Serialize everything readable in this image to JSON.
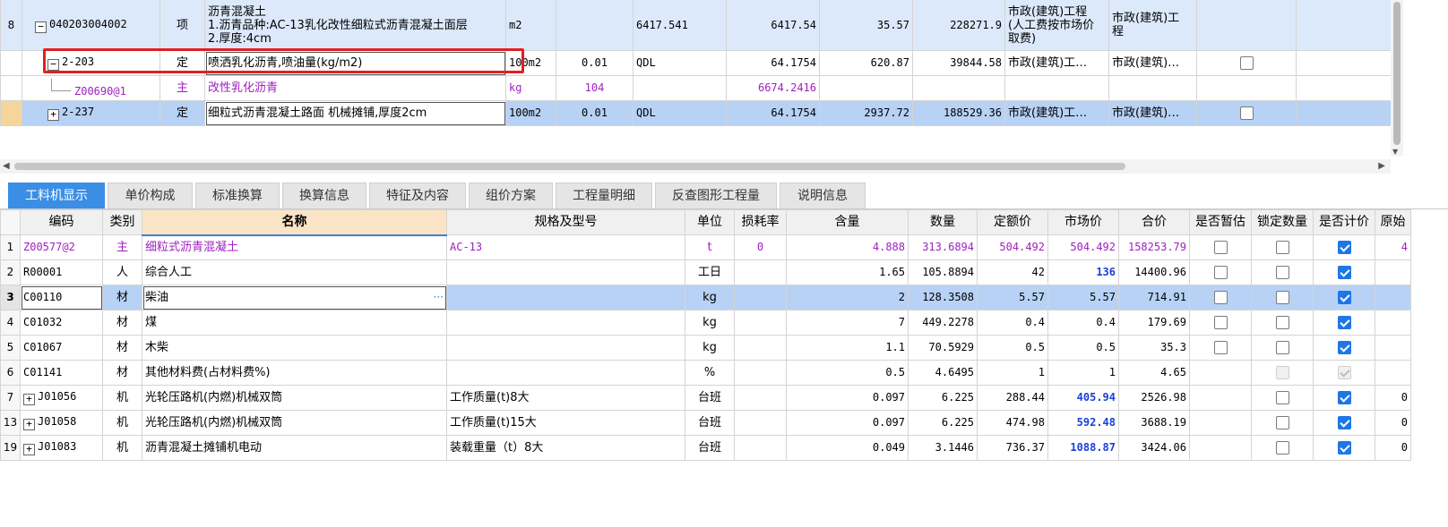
{
  "top_rows": [
    {
      "num": "8",
      "code": "040203004002",
      "expand": "−",
      "type": "项",
      "name_lines": [
        "沥青混凝土",
        "1.沥青品种:AC-13乳化改性细粒式沥青混凝土面层",
        "2.厚度:4cm"
      ],
      "unit": "m2",
      "qty_factor": "",
      "qty_expr": "6417.541",
      "quantity": "6417.54",
      "unit_price": "35.57",
      "total": "228271.9",
      "fee_type_lines": [
        "市政(建筑)工程",
        "(人工费按市场价",
        "取费)"
      ],
      "major_lines": [
        "市政(建筑)工",
        "程"
      ],
      "checkbox": "none"
    },
    {
      "num": "",
      "code": "2-203",
      "expand": "−",
      "type": "定",
      "name_lines": [
        "喷洒乳化沥青,喷油量(kg/m2)"
      ],
      "unit": "100m2",
      "qty_factor": "0.01",
      "qty_expr": "QDL",
      "quantity": "64.1754",
      "unit_price": "620.87",
      "total": "39844.58",
      "fee_type_lines": [
        "市政(建筑)工…"
      ],
      "major_lines": [
        "市政(建筑)…"
      ],
      "checkbox": "unchecked"
    },
    {
      "num": "",
      "code": "Z00690@1",
      "expand": "",
      "type": "主",
      "name_lines": [
        "改性乳化沥青"
      ],
      "unit": "kg",
      "qty_factor": "104",
      "qty_expr": "",
      "quantity": "6674.2416",
      "unit_price": "",
      "total": "",
      "fee_type_lines": [
        ""
      ],
      "major_lines": [
        ""
      ],
      "checkbox": "none"
    },
    {
      "num": "",
      "code": "2-237",
      "expand": "+",
      "type": "定",
      "name_lines": [
        "细粒式沥青混凝土路面 机械摊铺,厚度2cm"
      ],
      "unit": "100m2",
      "qty_factor": "0.01",
      "qty_expr": "QDL",
      "quantity": "64.1754",
      "unit_price": "2937.72",
      "total": "188529.36",
      "fee_type_lines": [
        "市政(建筑)工…"
      ],
      "major_lines": [
        "市政(建筑)…"
      ],
      "checkbox": "unchecked"
    }
  ],
  "tabs": [
    "工料机显示",
    "单价构成",
    "标准换算",
    "换算信息",
    "特征及内容",
    "组价方案",
    "工程量明细",
    "反查图形工程量",
    "说明信息"
  ],
  "bottom_headers": [
    "",
    "编码",
    "类别",
    "名称",
    "规格及型号",
    "单位",
    "损耗率",
    "含量",
    "数量",
    "定额价",
    "市场价",
    "合价",
    "是否暂估",
    "锁定数量",
    "是否计价",
    "原始"
  ],
  "bottom_rows": [
    {
      "num": "1",
      "expand": "",
      "code": "Z00577@2",
      "cat": "主",
      "name": "细粒式沥青混凝土",
      "spec": "AC-13",
      "unit": "t",
      "loss": "0",
      "content": "4.888",
      "qty": "313.6894",
      "quota": "504.492",
      "market": "504.492",
      "total": "158253.79",
      "est": "unchecked",
      "lock": "unchecked",
      "priced": "checked",
      "orig": "4",
      "style": "purple"
    },
    {
      "num": "2",
      "expand": "",
      "code": "R00001",
      "cat": "人",
      "name": "综合人工",
      "spec": "",
      "unit": "工日",
      "loss": "",
      "content": "1.65",
      "qty": "105.8894",
      "quota": "42",
      "market": "136",
      "total": "14400.96",
      "est": "unchecked",
      "lock": "unchecked",
      "priced": "checked",
      "orig": "",
      "style": "market-bold"
    },
    {
      "num": "3",
      "expand": "",
      "code": "C00110",
      "cat": "材",
      "name": "柴油",
      "spec": "",
      "unit": "kg",
      "loss": "",
      "content": "2",
      "qty": "128.3508",
      "quota": "5.57",
      "market": "5.57",
      "total": "714.91",
      "est": "unchecked",
      "lock": "unchecked",
      "priced": "checked",
      "orig": "",
      "style": "selected"
    },
    {
      "num": "4",
      "expand": "",
      "code": "C01032",
      "cat": "材",
      "name": "煤",
      "spec": "",
      "unit": "kg",
      "loss": "",
      "content": "7",
      "qty": "449.2278",
      "quota": "0.4",
      "market": "0.4",
      "total": "179.69",
      "est": "unchecked",
      "lock": "unchecked",
      "priced": "checked",
      "orig": "",
      "style": ""
    },
    {
      "num": "5",
      "expand": "",
      "code": "C01067",
      "cat": "材",
      "name": "木柴",
      "spec": "",
      "unit": "kg",
      "loss": "",
      "content": "1.1",
      "qty": "70.5929",
      "quota": "0.5",
      "market": "0.5",
      "total": "35.3",
      "est": "unchecked",
      "lock": "unchecked",
      "priced": "checked",
      "orig": "",
      "style": ""
    },
    {
      "num": "6",
      "expand": "",
      "code": "C01141",
      "cat": "材",
      "name": "其他材料费(占材料费%)",
      "spec": "",
      "unit": "%",
      "loss": "",
      "content": "0.5",
      "qty": "4.6495",
      "quota": "1",
      "market": "1",
      "total": "4.65",
      "est": "none",
      "lock": "disabled",
      "priced": "disabled-checked",
      "orig": "",
      "style": ""
    },
    {
      "num": "7",
      "expand": "+",
      "code": "J01056",
      "cat": "机",
      "name": "光轮压路机(内燃)机械双筒",
      "spec": "工作质量(t)8大",
      "unit": "台班",
      "loss": "",
      "content": "0.097",
      "qty": "6.225",
      "quota": "288.44",
      "market": "405.94",
      "total": "2526.98",
      "est": "none",
      "lock": "unchecked",
      "priced": "checked",
      "orig": "0",
      "style": "market-bold"
    },
    {
      "num": "13",
      "expand": "+",
      "code": "J01058",
      "cat": "机",
      "name": "光轮压路机(内燃)机械双筒",
      "spec": "工作质量(t)15大",
      "unit": "台班",
      "loss": "",
      "content": "0.097",
      "qty": "6.225",
      "quota": "474.98",
      "market": "592.48",
      "total": "3688.19",
      "est": "none",
      "lock": "unchecked",
      "priced": "checked",
      "orig": "0",
      "style": "market-bold"
    },
    {
      "num": "19",
      "expand": "+",
      "code": "J01083",
      "cat": "机",
      "name": "沥青混凝土摊铺机电动",
      "spec": "装载重量（t）8大",
      "unit": "台班",
      "loss": "",
      "content": "0.049",
      "qty": "3.1446",
      "quota": "736.37",
      "market": "1088.87",
      "total": "3424.06",
      "est": "none",
      "lock": "unchecked",
      "priced": "checked",
      "orig": "0",
      "style": "market-bold"
    }
  ]
}
